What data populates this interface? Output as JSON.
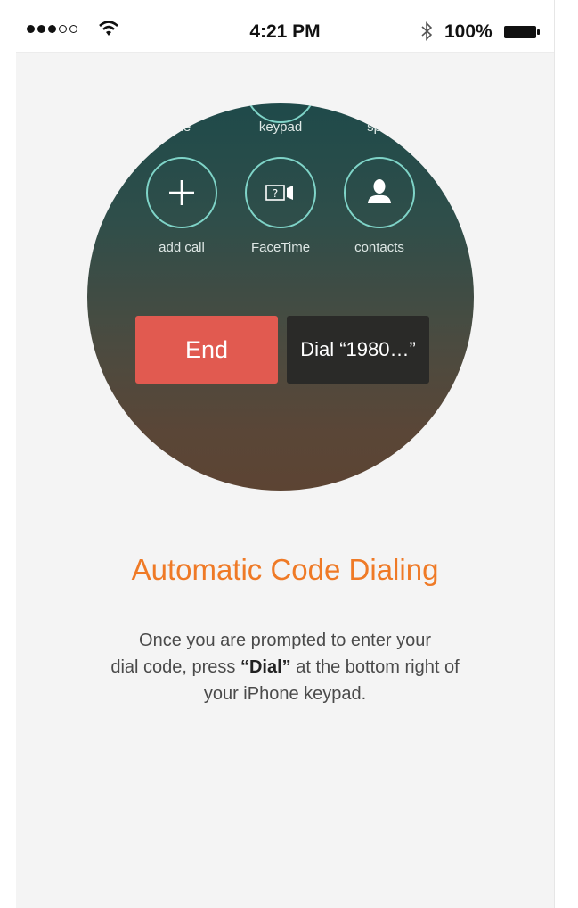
{
  "status_bar": {
    "time": "4:21 PM",
    "battery_pct": "100%",
    "signal_bars_filled": 3,
    "signal_bars_total": 5,
    "icons": [
      "signal-dots",
      "wifi-icon",
      "bluetooth-icon",
      "battery-icon"
    ]
  },
  "call_screen": {
    "top_row_labels": [
      "te",
      "keypad",
      "sp"
    ],
    "buttons": [
      {
        "label": "add call",
        "icon": "plus-icon"
      },
      {
        "label": "FaceTime",
        "icon": "facetime-icon"
      },
      {
        "label": "contacts",
        "icon": "person-icon"
      }
    ],
    "end_label": "End",
    "dial_label": "Dial “1980…”"
  },
  "content": {
    "heading": "Automatic Code Dialing",
    "desc_line1": "Once you are prompted to enter your",
    "desc_line2_pre": "dial code, press ",
    "desc_line2_bold": "“Dial”",
    "desc_line2_post": " at the bottom right of",
    "desc_line3": "your iPhone keypad."
  },
  "colors": {
    "accent": "#ef7a26",
    "end_button": "#e15a50",
    "dial_button": "#2a2a28",
    "ring": "#7fd4c8"
  }
}
